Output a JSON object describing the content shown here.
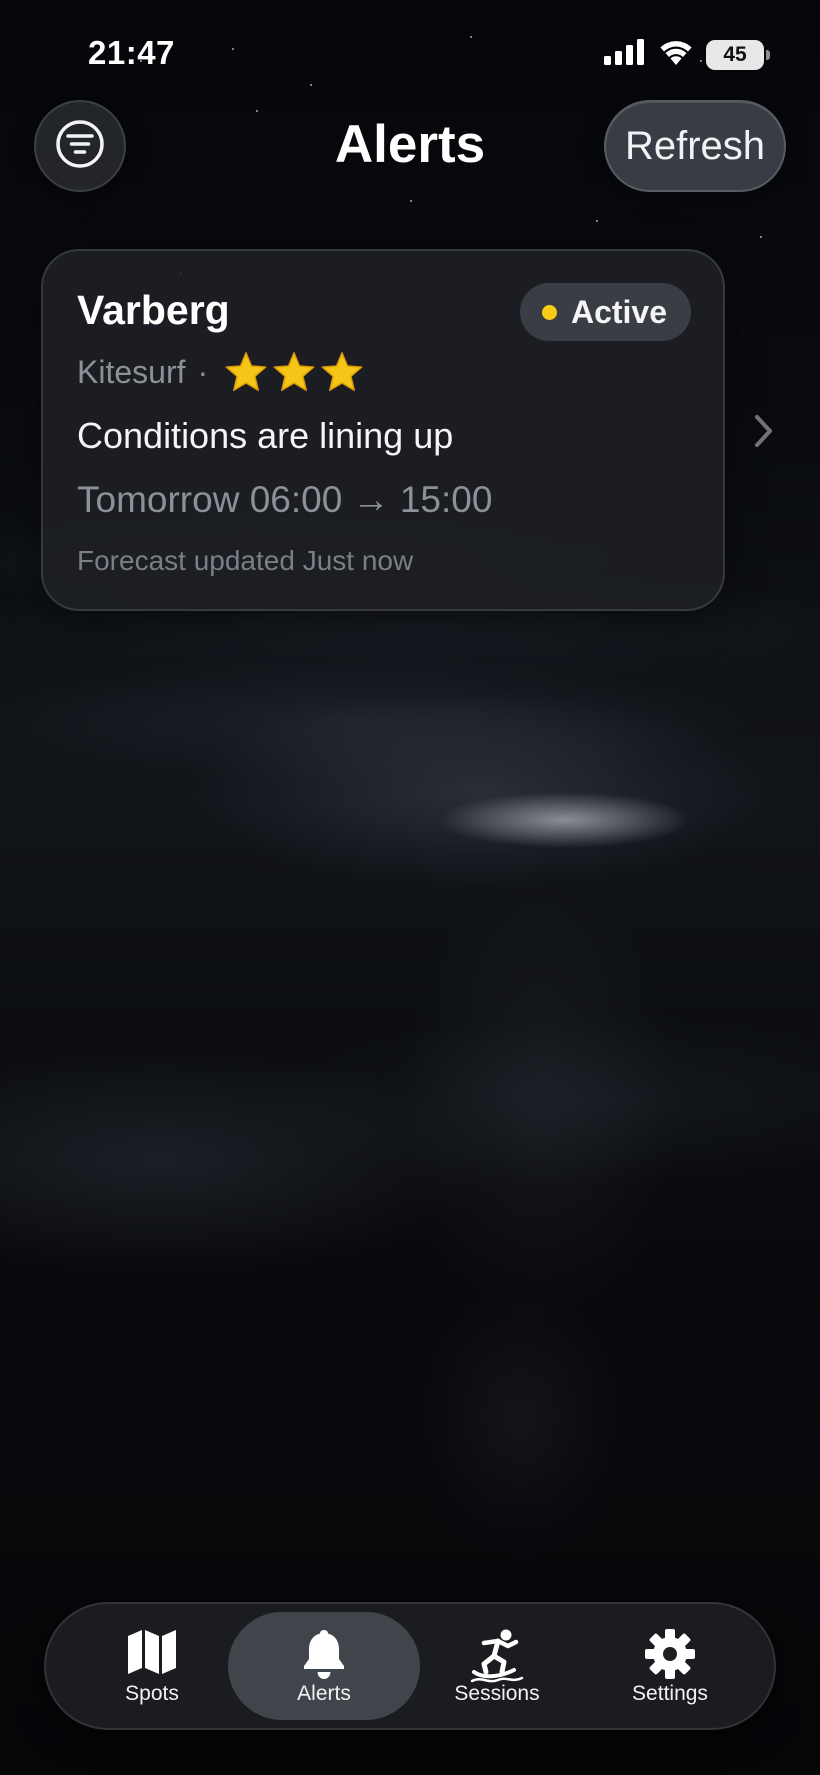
{
  "status_bar": {
    "time": "21:47",
    "battery": "45"
  },
  "header": {
    "title": "Alerts",
    "refresh_label": "Refresh"
  },
  "alerts": [
    {
      "spot": "Varberg",
      "status": "Active",
      "sport": "Kitesurf",
      "separator": "·",
      "rating": 3,
      "headline": "Conditions are lining up",
      "window": "Tomorrow 06:00 → 15:00",
      "updated": "Forecast updated Just now"
    }
  ],
  "tabs": [
    {
      "label": "Spots",
      "icon": "map-icon"
    },
    {
      "label": "Alerts",
      "icon": "bell-icon",
      "selected": true
    },
    {
      "label": "Sessions",
      "icon": "surfer-icon"
    },
    {
      "label": "Settings",
      "icon": "gear-icon"
    }
  ],
  "colors": {
    "active_dot": "#f6cd14",
    "star": "#f5c518",
    "background": "#07080b"
  }
}
